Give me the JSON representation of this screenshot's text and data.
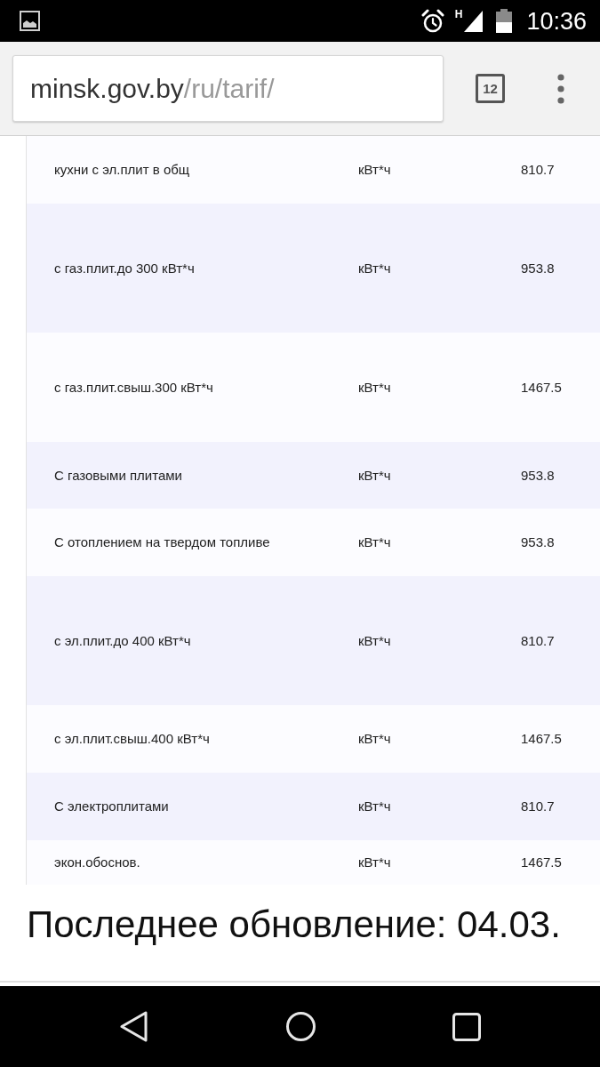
{
  "status_bar": {
    "network_type": "H",
    "time": "10:36"
  },
  "browser": {
    "address": {
      "host": "minsk.gov.by",
      "path": "/ru/tarif/"
    },
    "tab_count": "12"
  },
  "table": {
    "rows": [
      [
        "кухни с эл.плит в общ",
        "кВт*ч",
        "810.7"
      ],
      [
        "с газ.плит.до 300 кВт*ч",
        "кВт*ч",
        "953.8"
      ],
      [
        "с газ.плит.свыш.300 кВт*ч",
        "кВт*ч",
        "1467.5"
      ],
      [
        "С газовыми плитами",
        "кВт*ч",
        "953.8"
      ],
      [
        "С отоплением на твердом топливе",
        "кВт*ч",
        "953.8"
      ],
      [
        "с эл.плит.до 400 кВт*ч",
        "кВт*ч",
        "810.7"
      ],
      [
        "с эл.плит.свыш.400 кВт*ч",
        "кВт*ч",
        "1467.5"
      ],
      [
        "С электроплитами",
        "кВт*ч",
        "810.7"
      ],
      [
        "экон.обоснов.",
        "кВт*ч",
        "1467.5"
      ]
    ]
  },
  "footer": {
    "text": "Последнее обновление: 04.03."
  }
}
